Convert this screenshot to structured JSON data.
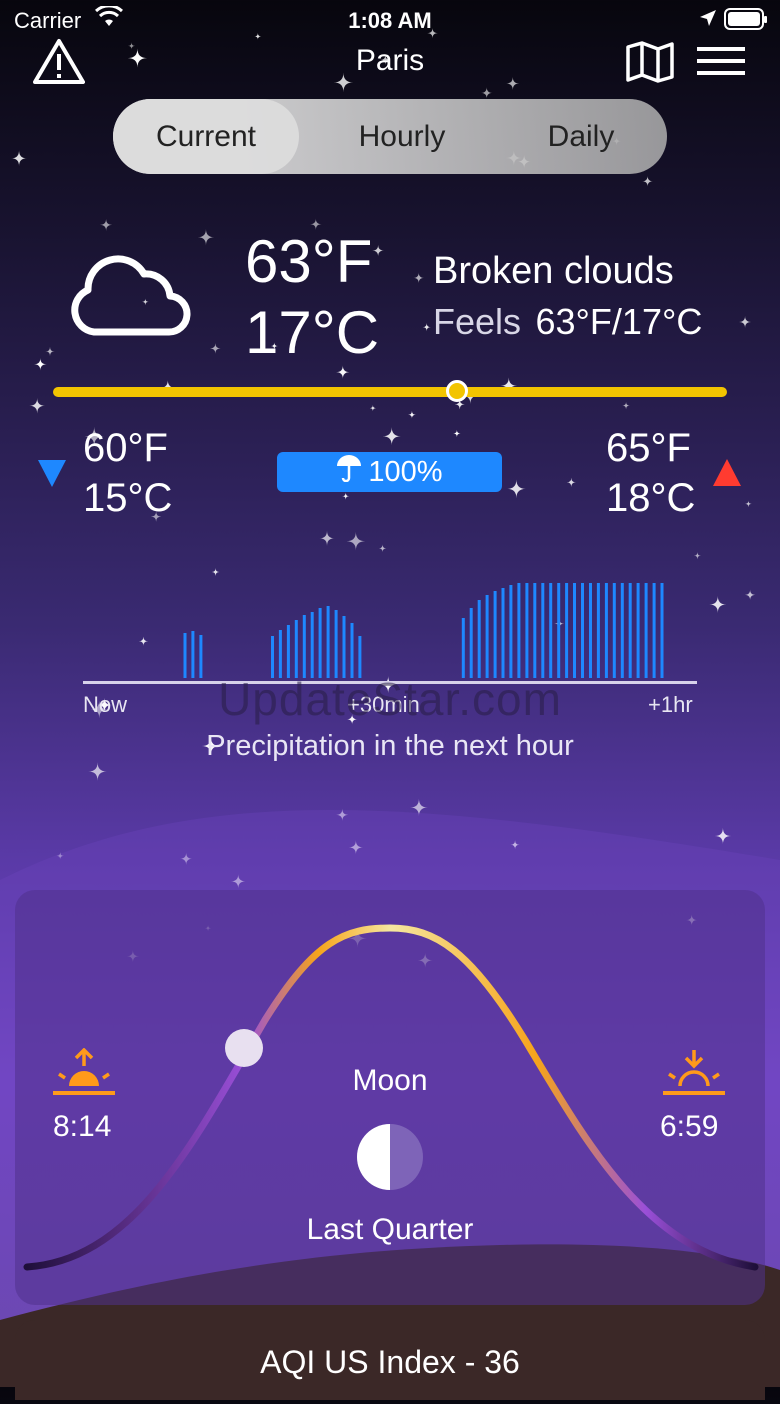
{
  "status_bar": {
    "carrier": "Carrier",
    "time": "1:08 AM"
  },
  "header": {
    "city": "Paris"
  },
  "tabs": [
    {
      "label": "Current",
      "active": true
    },
    {
      "label": "Hourly",
      "active": false
    },
    {
      "label": "Daily",
      "active": false
    }
  ],
  "current": {
    "temp_f": "63°F",
    "temp_c": "17°C",
    "description": "Broken clouds",
    "feels_label": "Feels",
    "feels_value": "63°F/17°C",
    "low_f": "60°F",
    "low_c": "15°C",
    "high_f": "65°F",
    "high_c": "18°C",
    "precip_chance": "100%",
    "temp_position_fraction": 0.6
  },
  "precip_chart": {
    "label_start": "Now",
    "label_mid": "+30min",
    "label_end": "+1hr",
    "title": "Precipitation in the next hour"
  },
  "watermark": "UpdateStar.com",
  "sun_moon": {
    "sunrise": "8:14",
    "sunset": "6:59",
    "moon_label": "Moon",
    "moon_phase": "Last Quarter"
  },
  "aqi": {
    "label": "AQI US Index - 36"
  },
  "colors": {
    "accent_yellow": "#f2c400",
    "precip_blue": "#1e88ff",
    "low_arrow": "#1e88ff",
    "high_arrow": "#ff3b30",
    "sun_orange": "#ff9a1a"
  },
  "chart_data": {
    "type": "bar",
    "title": "Precipitation in the next hour",
    "xlabel": "",
    "ylabel": "",
    "x_ticks": [
      "Now",
      "+30min",
      "+1hr"
    ],
    "values": [
      0,
      0,
      0,
      0,
      0,
      0,
      0,
      0,
      0,
      0,
      0.45,
      0.47,
      0.43,
      0,
      0,
      0,
      0,
      0,
      0,
      0,
      0,
      0.42,
      0.48,
      0.53,
      0.58,
      0.63,
      0.66,
      0.7,
      0.72,
      0.68,
      0.62,
      0.55,
      0.42,
      0,
      0,
      0,
      0,
      0,
      0,
      0,
      0,
      0,
      0,
      0,
      0,
      0.6,
      0.7,
      0.78,
      0.83,
      0.87,
      0.9,
      0.93,
      0.95,
      0.95,
      0.95,
      0.95,
      0.95,
      0.95,
      0.95,
      0.95,
      0.95,
      0.95,
      0.95,
      0.95,
      0.95,
      0.95,
      0.95,
      0.95,
      0.95,
      0.95,
      0.95
    ]
  }
}
